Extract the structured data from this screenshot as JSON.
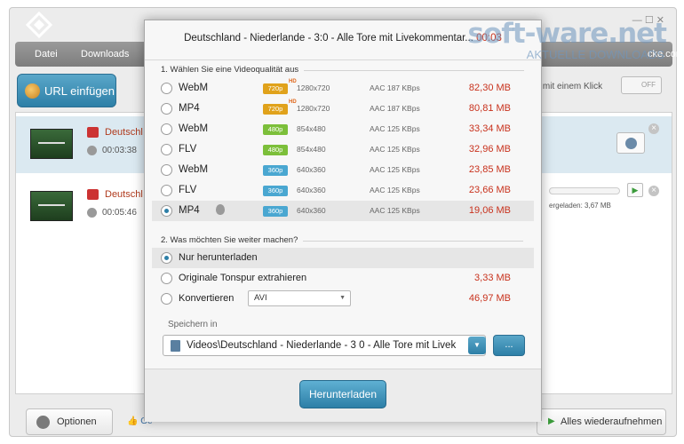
{
  "watermark": {
    "brand": "soft-ware.net",
    "tagline": "AKTUELLE DOWNLOADS"
  },
  "app": {
    "menu": {
      "file": "Datei",
      "downloads": "Downloads"
    },
    "header_right_text": "cke.com",
    "url_button": "URL einfügen",
    "smart_mode_text": "ad mit einem Klick",
    "toggle_label": "OFF",
    "list": [
      {
        "title": "Deutschl",
        "duration": "00:03:38"
      },
      {
        "title": "Deutschl",
        "duration": "00:05:46",
        "progress_text": "ergeladen:  3,67 MB"
      }
    ],
    "options_button": "Optionen",
    "like_text": "Ge",
    "resume_button": "Alles wiederaufnehmen"
  },
  "dialog": {
    "title": "Deutschland - Niederlande - 3:0 - Alle Tore mit Livekommentar...",
    "title_duration": "00:03",
    "section1": "1. Wählen Sie eine Videoqualität aus",
    "qualities": [
      {
        "format": "WebM",
        "badge": "720p",
        "badge_class": "b720",
        "hd": "HD",
        "resolution": "1280x720",
        "audio": "AAC 187 KBps",
        "size": "82,30 MB",
        "selected": false,
        "apple": false
      },
      {
        "format": "MP4",
        "badge": "720p",
        "badge_class": "b720",
        "hd": "HD",
        "resolution": "1280x720",
        "audio": "AAC 187 KBps",
        "size": "80,81 MB",
        "selected": false,
        "apple": false
      },
      {
        "format": "WebM",
        "badge": "480p",
        "badge_class": "b480",
        "hd": "",
        "resolution": "854x480",
        "audio": "AAC 125 KBps",
        "size": "33,34 MB",
        "selected": false,
        "apple": false
      },
      {
        "format": "FLV",
        "badge": "480p",
        "badge_class": "b480",
        "hd": "",
        "resolution": "854x480",
        "audio": "AAC 125 KBps",
        "size": "32,96 MB",
        "selected": false,
        "apple": false
      },
      {
        "format": "WebM",
        "badge": "360p",
        "badge_class": "b360",
        "hd": "",
        "resolution": "640x360",
        "audio": "AAC 125 KBps",
        "size": "23,85 MB",
        "selected": false,
        "apple": false
      },
      {
        "format": "FLV",
        "badge": "360p",
        "badge_class": "b360",
        "hd": "",
        "resolution": "640x360",
        "audio": "AAC 125 KBps",
        "size": "23,66 MB",
        "selected": false,
        "apple": false
      },
      {
        "format": "MP4",
        "badge": "360p",
        "badge_class": "b360",
        "hd": "",
        "resolution": "640x360",
        "audio": "AAC 125 KBps",
        "size": "19,06 MB",
        "selected": true,
        "apple": true
      }
    ],
    "section2": "2. Was möchten Sie weiter machen?",
    "actions": {
      "download_only": "Nur herunterladen",
      "extract_audio": "Originale Tonspur extrahieren",
      "extract_size": "3,33 MB",
      "convert": "Konvertieren",
      "convert_format": "AVI",
      "convert_size": "46,97 MB"
    },
    "save_label": "Speichern in",
    "save_path": "Videos\\Deutschland - Niederlande - 3 0 - Alle Tore mit Livek",
    "browse_label": "...",
    "download_button": "Herunterladen"
  }
}
